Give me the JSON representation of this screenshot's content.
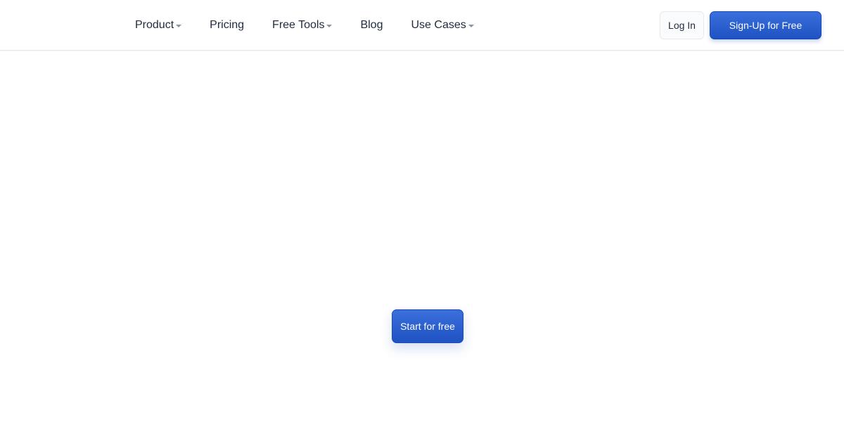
{
  "header": {
    "nav": [
      {
        "label": "Product",
        "has_dropdown": true
      },
      {
        "label": "Pricing",
        "has_dropdown": false
      },
      {
        "label": "Free Tools",
        "has_dropdown": true
      },
      {
        "label": "Blog",
        "has_dropdown": false
      },
      {
        "label": "Use Cases",
        "has_dropdown": true
      }
    ],
    "login_label": "Log In",
    "signup_label": "Sign-Up for Free"
  },
  "main": {
    "cta_label": "Start for free"
  },
  "colors": {
    "primary": "#2459CF",
    "nav_text": "#1F2A3D",
    "caret": "#8A94A3",
    "border": "#E3E6EA"
  },
  "icons": {
    "dropdown": "chevron-down-icon"
  }
}
